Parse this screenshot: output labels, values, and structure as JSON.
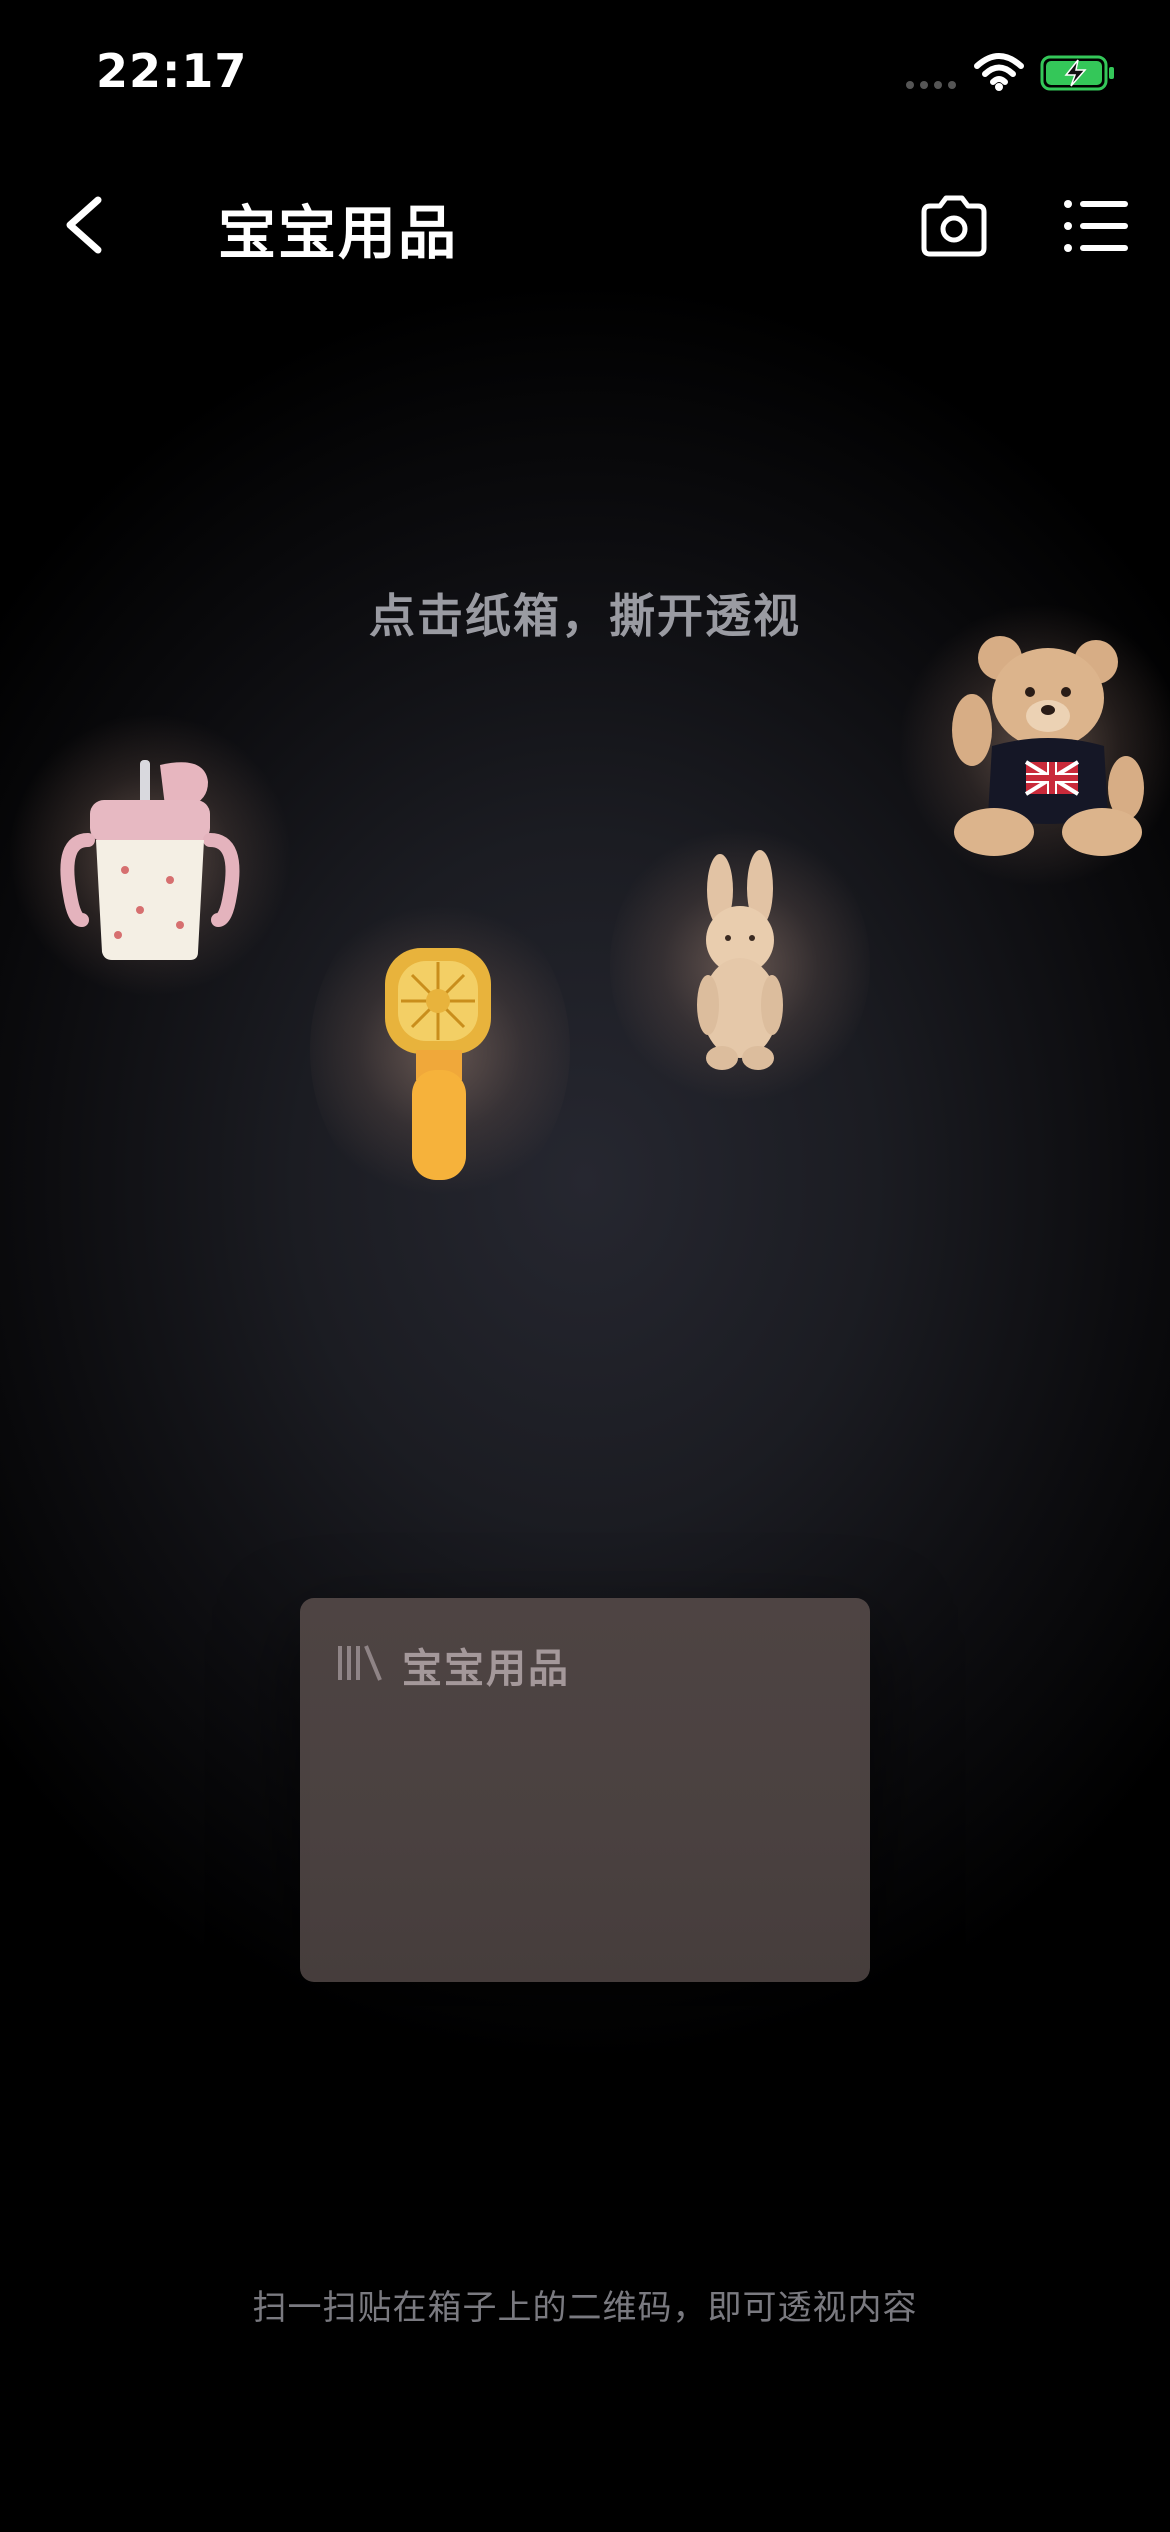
{
  "status_bar": {
    "time": "22:17",
    "icons": [
      "signal-dots-icon",
      "wifi-icon",
      "battery-charging-icon"
    ],
    "battery_color": "#34c759"
  },
  "nav": {
    "title": "宝宝用品",
    "back_icon": "chevron-left-icon",
    "camera_icon": "camera-icon",
    "menu_icon": "list-menu-icon"
  },
  "hint_top": "点击纸箱，撕开透视",
  "items": [
    {
      "name": "sippy-cup",
      "icon": "sippy-cup-icon"
    },
    {
      "name": "handheld-fan",
      "icon": "handheld-fan-icon"
    },
    {
      "name": "plush-bunny",
      "icon": "plush-bunny-icon"
    },
    {
      "name": "teddy-bear",
      "icon": "teddy-bear-icon"
    }
  ],
  "box": {
    "label": "宝宝用品",
    "icon": "barcode-icon",
    "color": "#4a4140"
  },
  "hint_bottom": "扫一扫贴在箱子上的二维码，即可透视内容"
}
